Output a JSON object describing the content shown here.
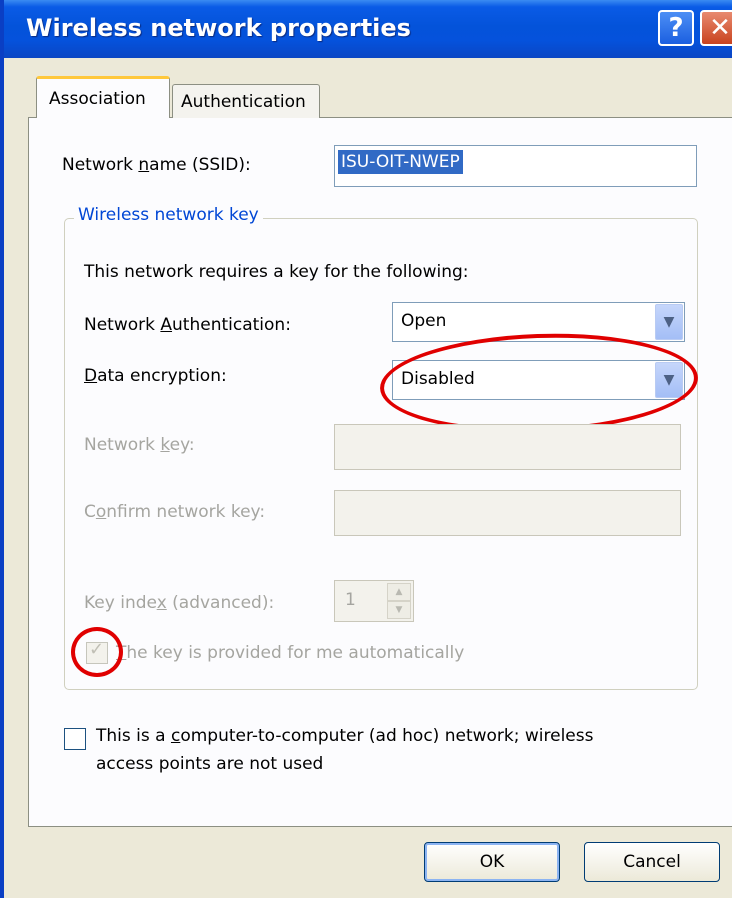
{
  "window": {
    "title": "Wireless network properties",
    "help_label": "?",
    "close_label": "✕"
  },
  "tabs": [
    {
      "label": "Association",
      "active": true
    },
    {
      "label": "Authentication",
      "active": false
    }
  ],
  "ssid": {
    "label_pre": "Network ",
    "label_key": "n",
    "label_post": "ame (SSID):",
    "value": "ISU-OIT-NWEP"
  },
  "wireless_key": {
    "group_title": "Wireless network key",
    "description": "This network requires a key for the following:",
    "auth_label_pre": "Network ",
    "auth_label_key": "A",
    "auth_label_post": "uthentication:",
    "auth_value": "Open",
    "enc_label_key": "D",
    "enc_label_post": "ata encryption:",
    "enc_value": "Disabled",
    "netkey_label_pre": "Network ",
    "netkey_label_key": "k",
    "netkey_label_post": "ey:",
    "confirm_label_pre": "C",
    "confirm_label_key": "o",
    "confirm_label_post": "nfirm network key:",
    "index_label_pre": "Key inde",
    "index_label_key": "x",
    "index_label_post": " (advanced):",
    "index_value": "1",
    "auto_key_label_key": "T",
    "auto_key_label_post": "he key is provided for me automatically",
    "auto_key_checked": true
  },
  "adhoc": {
    "line1_pre": "This is a ",
    "line1_key": "c",
    "line1_post": "omputer-to-computer (ad hoc) network; wireless",
    "line2": "access points are not used",
    "checked": false
  },
  "buttons": {
    "ok": "OK",
    "cancel": "Cancel"
  },
  "icons": {
    "dropdown": "chevron-down-icon",
    "spin_up": "arrow-up-icon",
    "spin_down": "arrow-down-icon",
    "check": "checkmark-icon"
  },
  "colors": {
    "title_bar": "#0453da",
    "group_title": "#0046d5",
    "selection": "#316ac5",
    "annotation": "#e00000",
    "active_tab_accent": "#ffc83c"
  }
}
